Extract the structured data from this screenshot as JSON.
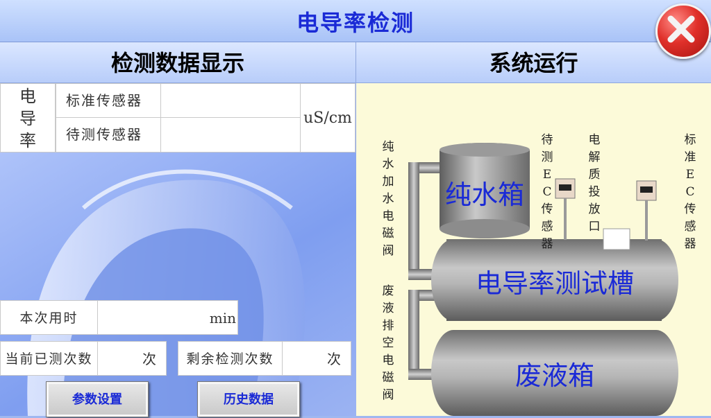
{
  "app": {
    "title": "电导率检测"
  },
  "sections": {
    "left_title": "检测数据显示",
    "right_title": "系统运行"
  },
  "conductivity": {
    "label": "电导率",
    "rows": [
      {
        "label": "标准传感器",
        "value": ""
      },
      {
        "label": "待测传感器",
        "value": ""
      }
    ],
    "unit": "uS/cm"
  },
  "time_row": {
    "label": "本次用时",
    "value": "min"
  },
  "count_rows": {
    "done_label": "当前已测次数",
    "done_value": "次",
    "remain_label": "剩余检测次数",
    "remain_value": "次"
  },
  "buttons": {
    "settings": "参数设置",
    "history": "历史数据"
  },
  "diagram": {
    "pure_valve_label": "纯水加水电磁阀",
    "waste_valve_label": "废液排空电磁阀",
    "test_sensor_label": "待测EC传感器",
    "dosing_port_label": "电解质投放口",
    "standard_sensor_label": "标准EC传感器",
    "pure_tank": "纯水箱",
    "test_tank": "电导率测试槽",
    "waste_tank": "废液箱"
  },
  "colors": {
    "title_text": "#1a2ad6",
    "panel_bg": "#fcfad9",
    "close_button": "#d32b25"
  },
  "icons": {
    "close": "close-x-icon",
    "sensor": "sensor-icon"
  }
}
